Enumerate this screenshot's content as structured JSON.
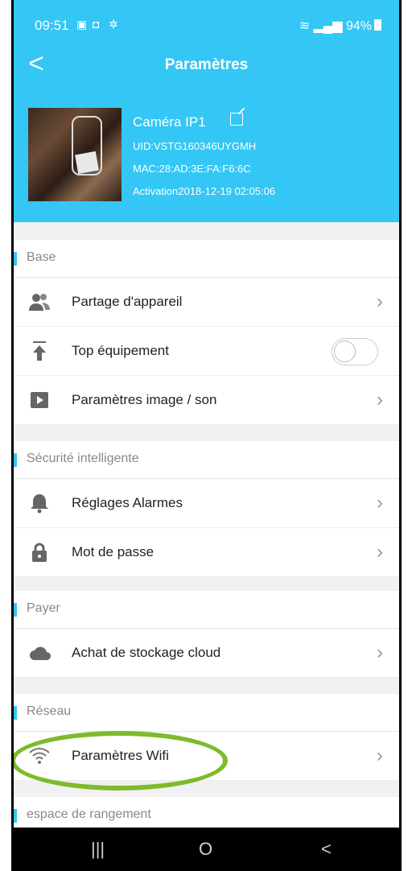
{
  "status": {
    "time": "09:51",
    "battery": "94%",
    "left_icons": [
      "image-icon",
      "gallery-icon",
      "settings-gear-icon"
    ],
    "right_icons": [
      "wifi-icon",
      "signal-icon"
    ]
  },
  "header": {
    "back_label": "<",
    "title": "Paramètres"
  },
  "camera": {
    "name": "Caméra IP1",
    "uid": "UID:VSTG160346UYGMH",
    "mac": "MAC:28:AD:3E:FA:F6:6C",
    "activation": "Activation2018-12-19 02:05:06"
  },
  "sections": [
    {
      "title": "Base",
      "items": [
        "Partage d'appareil",
        "Top équipement",
        "Paramètres image / son"
      ]
    },
    {
      "title": "Sécurité intelligente",
      "items": [
        "Réglages Alarmes",
        "Mot de passe"
      ]
    },
    {
      "title": "Payer",
      "items": [
        "Achat de stockage cloud"
      ]
    },
    {
      "title": "Réseau",
      "items": [
        "Paramètres Wifi"
      ]
    },
    {
      "title": "espace de rangement",
      "items": []
    }
  ],
  "toggle": {
    "top_equipment_enabled": false
  },
  "colors": {
    "accent": "#34c6f4",
    "highlight": "#7dbb2a"
  },
  "nav": {
    "recents": "|||",
    "home": "O",
    "back": "<"
  }
}
